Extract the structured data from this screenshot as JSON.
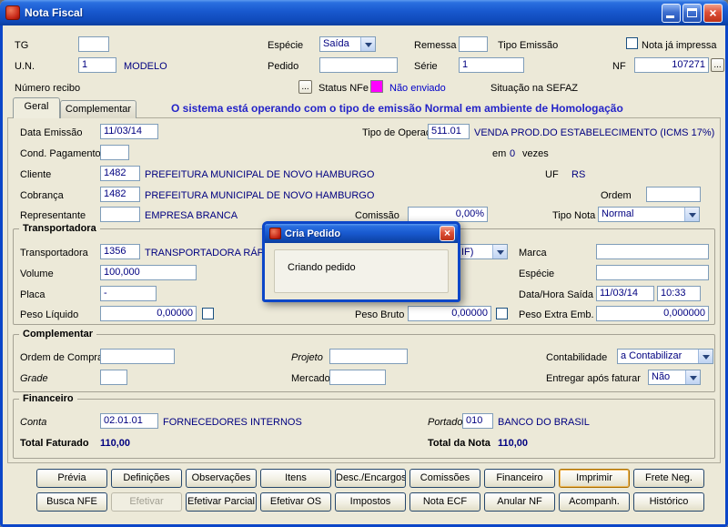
{
  "window": {
    "title": "Nota Fiscal"
  },
  "topform": {
    "tg_label": "TG",
    "especie_label": "Espécie",
    "especie_value": "Saída",
    "remessa_label": "Remessa",
    "tipo_emissao_label": "Tipo Emissão",
    "nota_impressa_label": "Nota já impressa",
    "un_label": "U.N.",
    "un_value": "1",
    "un_desc": "MODELO",
    "pedido_label": "Pedido",
    "serie_label": "Série",
    "serie_value": "1",
    "nf_label": "NF",
    "nf_value": "107271",
    "nf_browse": "...",
    "numero_recibo_label": "Número recibo",
    "recibo_browse": "...",
    "status_nfe_label": "Status NFe",
    "status_nfe_value": "Não enviado",
    "situacao_sefaz_label": "Situação na SEFAZ"
  },
  "tabs": {
    "geral": "Geral",
    "complementar": "Complementar",
    "banner": "O sistema está operando com o tipo de emissão Normal em ambiente de Homologação"
  },
  "geral": {
    "data_emissao_label": "Data Emissão",
    "data_emissao_value": "11/03/14",
    "tipo_operacao_label": "Tipo de Operação",
    "tipo_operacao_code": "511.01",
    "tipo_operacao_desc": "VENDA PROD.DO ESTABELECIMENTO (ICMS 17%)",
    "cond_pagamento_label": "Cond. Pagamento",
    "em_label": "em",
    "parcelas_value": "0",
    "vezes_label": "vezes",
    "cliente_label": "Cliente",
    "cliente_code": "1482",
    "cliente_desc": "PREFEITURA MUNICIPAL DE NOVO HAMBURGO",
    "uf_label": "UF",
    "uf_value": "RS",
    "cobranca_label": "Cobrança",
    "cobranca_code": "1482",
    "cobranca_desc": "PREFEITURA MUNICIPAL DE NOVO HAMBURGO",
    "ordem_label": "Ordem",
    "representante_label": "Representante",
    "representante_desc": "EMPRESA BRANCA",
    "comissao_label": "Comissão",
    "comissao_value": "0,00%",
    "tipo_nota_label": "Tipo Nota",
    "tipo_nota_value": "Normal"
  },
  "transportadora": {
    "group_title": "Transportadora",
    "transportadora_label": "Transportadora",
    "transportadora_code": "1356",
    "transportadora_desc": "TRANSPORTADORA RÁPIDA",
    "frete_fragment": "IF)",
    "marca_label": "Marca",
    "volume_label": "Volume",
    "volume_value": "100,000",
    "especie_label": "Espécie",
    "placa_label": "Placa",
    "placa_value": "-",
    "data_hora_saida_label": "Data/Hora Saída",
    "data_saida_value": "11/03/14",
    "hora_saida_value": "10:33",
    "peso_liquido_label": "Peso Líquido",
    "peso_liquido_value": "0,00000",
    "peso_bruto_label": "Peso Bruto",
    "peso_bruto_value": "0,00000",
    "peso_extra_label": "Peso Extra Emb.",
    "peso_extra_value": "0,000000"
  },
  "complementar": {
    "group_title": "Complementar",
    "ordem_compra_label": "Ordem de Compra",
    "projeto_label": "Projeto",
    "contabilidade_label": "Contabilidade",
    "contabilidade_value": "a Contabilizar",
    "grade_label": "Grade",
    "mercado_label": "Mercado",
    "entregar_label": "Entregar após faturar",
    "entregar_value": "Não"
  },
  "financeiro": {
    "group_title": "Financeiro",
    "conta_label": "Conta",
    "conta_code": "02.01.01",
    "conta_desc": "FORNECEDORES INTERNOS",
    "portador_label": "Portador",
    "portador_code": "010",
    "portador_desc": "BANCO DO BRASIL",
    "total_faturado_label": "Total Faturado",
    "total_faturado_value": "110,00",
    "total_nota_label": "Total da Nota",
    "total_nota_value": "110,00"
  },
  "buttons": {
    "row1": [
      "Prévia",
      "Definições",
      "Observações",
      "Itens",
      "Desc./Encargos",
      "Comissões",
      "Financeiro",
      "Imprimir",
      "Frete Neg."
    ],
    "row2": [
      "Busca NFE",
      "Efetivar",
      "Efetivar Parcial",
      "Efetivar OS",
      "Impostos",
      "Nota ECF",
      "Anular NF",
      "Acompanh.",
      "Histórico"
    ]
  },
  "dialog": {
    "title": "Cria Pedido",
    "message": "Criando pedido"
  },
  "colors": {
    "status_nfe": "#FF00FF",
    "value_text": "#000080",
    "banner_text": "#2424C8"
  }
}
